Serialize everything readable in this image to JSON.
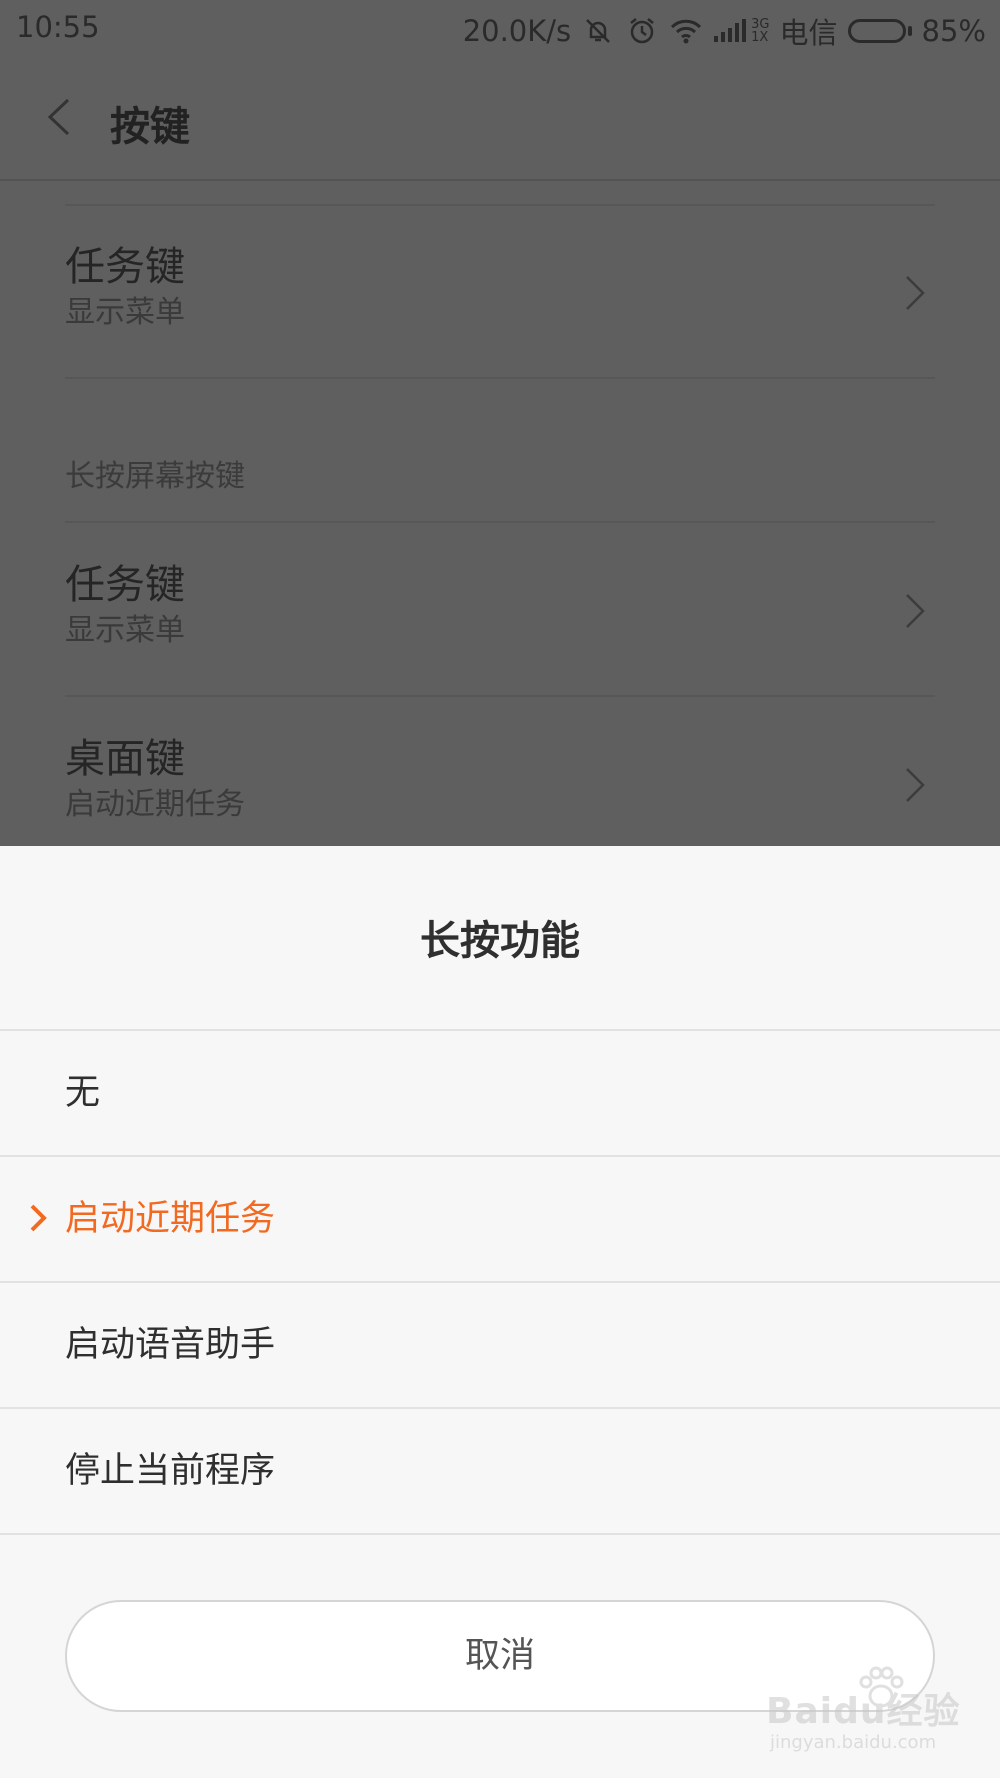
{
  "status_bar": {
    "time": "10:55",
    "net_speed": "20.0K/s",
    "icons": [
      "mute-icon",
      "alarm-icon",
      "wifi-icon",
      "signal-icon"
    ],
    "network_top": "3G",
    "network_bottom": "1X",
    "carrier": "电信",
    "battery_percent": "85%",
    "battery_level": 0.85
  },
  "header": {
    "title": "按键"
  },
  "background_list": {
    "items": [
      {
        "title": "任务键",
        "subtitle": "显示菜单"
      },
      {
        "title": "任务键",
        "subtitle": "显示菜单"
      },
      {
        "title": "桌面键",
        "subtitle": "启动近期任务"
      }
    ],
    "section_header": "长按屏幕按键"
  },
  "sheet": {
    "title": "长按功能",
    "options": [
      {
        "label": "无",
        "selected": false
      },
      {
        "label": "启动近期任务",
        "selected": true
      },
      {
        "label": "启动语音助手",
        "selected": false
      },
      {
        "label": "停止当前程序",
        "selected": false
      }
    ],
    "cancel_label": "取消"
  },
  "watermark": {
    "main": "Baidu经验",
    "sub": "jingyan.baidu.com"
  },
  "colors": {
    "accent": "#f26a21",
    "scrim": "#5f5f5f",
    "sheet_bg": "#f7f7f7"
  }
}
